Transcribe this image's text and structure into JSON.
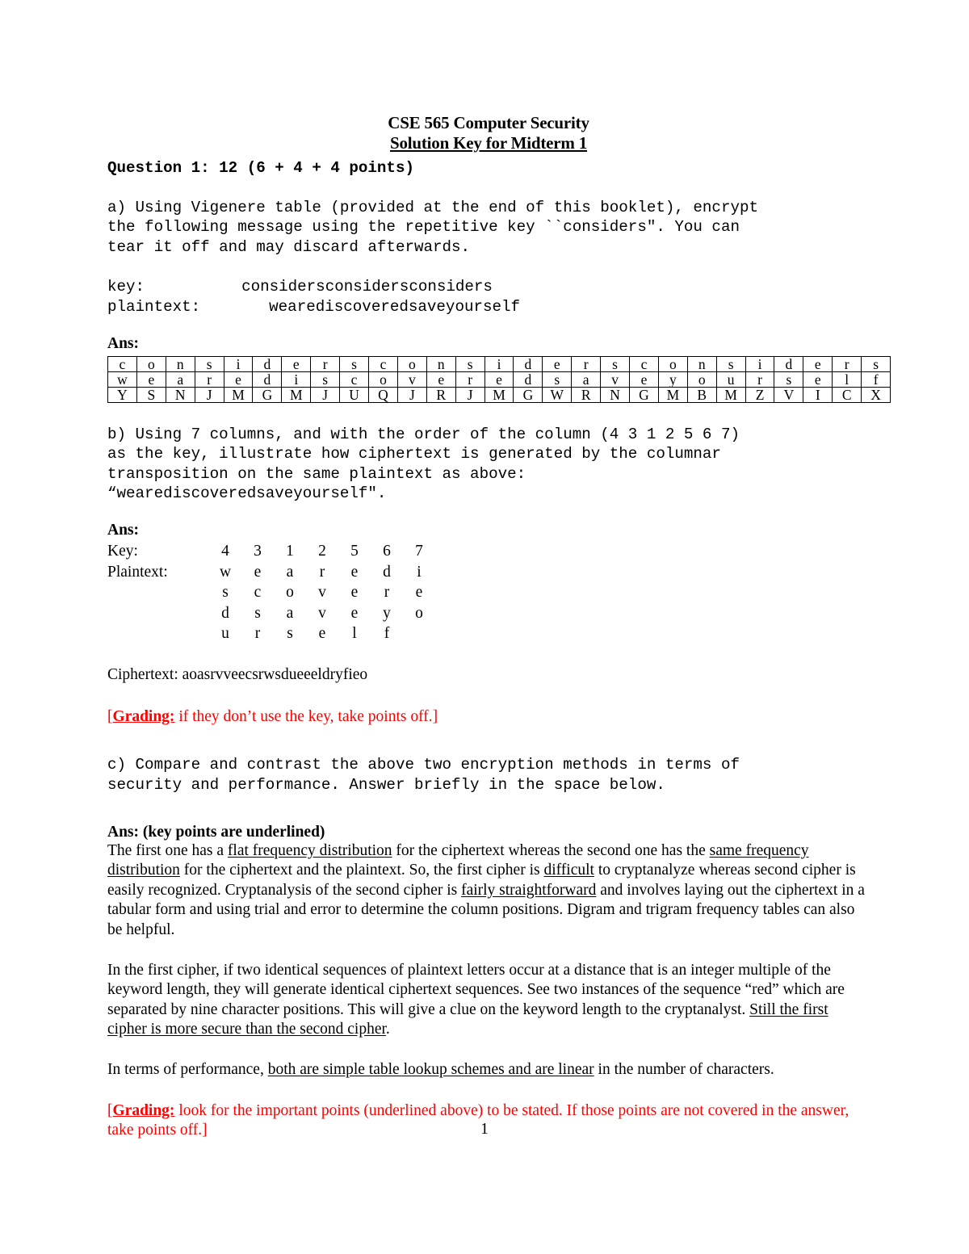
{
  "document": {
    "title": "CSE 565 Computer Security",
    "subtitle": "Solution Key for Midterm 1",
    "page_number": "1",
    "accent_red": "#ff0000"
  },
  "question": {
    "heading": "Question 1: 12 (6 + 4 + 4 points)",
    "part_a": {
      "text": "a) Using Vigenere table (provided at the end of this booklet), encrypt\nthe following message using the repetitive key ``considers\". You can\ntear it off and may discard afterwards.",
      "key_label": "key:",
      "key_value": "considersconsidersconsiders",
      "plaintext_label": "plaintext:",
      "plaintext_value": "wearediscoveredsaveyourself",
      "ans_label": "Ans:",
      "table": {
        "key_row": [
          "c",
          "o",
          "n",
          "s",
          "i",
          "d",
          "e",
          "r",
          "s",
          "c",
          "o",
          "n",
          "s",
          "i",
          "d",
          "e",
          "r",
          "s",
          "c",
          "o",
          "n",
          "s",
          "i",
          "d",
          "e",
          "r",
          "s"
        ],
        "plain_row": [
          "w",
          "e",
          "a",
          "r",
          "e",
          "d",
          "i",
          "s",
          "c",
          "o",
          "v",
          "e",
          "r",
          "e",
          "d",
          "s",
          "a",
          "v",
          "e",
          "y",
          "o",
          "u",
          "r",
          "s",
          "e",
          "l",
          "f"
        ],
        "cipher_row": [
          "Y",
          "S",
          "N",
          "J",
          "M",
          "G",
          "M",
          "J",
          "U",
          "Q",
          "J",
          "R",
          "J",
          "M",
          "G",
          "W",
          "R",
          "N",
          "G",
          "M",
          "B",
          "M",
          "Z",
          "V",
          "I",
          "C",
          "X"
        ]
      }
    },
    "part_b": {
      "text": "b) Using 7 columns, and with the order of the column (4 3 1 2 5 6 7)\nas the key, illustrate how ciphertext is generated by the columnar\ntransposition on the same plaintext as above:\n“wearediscoveredsaveyourself\".",
      "ans_label": "Ans:",
      "key_label": "Key:",
      "key_order": [
        "4",
        "3",
        "1",
        "2",
        "5",
        "6",
        "7"
      ],
      "plaintext_label": "Plaintext:",
      "grid_rows": [
        [
          "w",
          "e",
          "a",
          "r",
          "e",
          "d",
          "i"
        ],
        [
          "s",
          "c",
          "o",
          "v",
          "e",
          "r",
          "e"
        ],
        [
          "d",
          "s",
          "a",
          "v",
          "e",
          "y",
          "o"
        ],
        [
          "u",
          "r",
          "s",
          "e",
          "l",
          "f",
          ""
        ]
      ],
      "ciphertext_label": "Ciphertext:",
      "ciphertext_value": "aoasrvveecsrwsdueeeldryfieo",
      "grading_open": "[",
      "grading_bold": "Grading:",
      "grading_text": " if they don’t use the key, take points off.]"
    },
    "part_c": {
      "text": "c) Compare and contrast the above two encryption methods in terms of\nsecurity and performance. Answer briefly in the space below.",
      "ans_label": "Ans: (key points are underlined)",
      "paragraph1": {
        "s1": "The first one has a ",
        "u1": "flat frequency distribution",
        "s2": " for the ciphertext whereas the second one has the ",
        "u2": "same frequency distribution",
        "s3": " for the ciphertext and the plaintext. So, the first cipher is ",
        "u3": "difficult",
        "s4": " to cryptanalyze whereas second cipher is easily recognized. Cryptanalysis of the second cipher is ",
        "u4": "fairly straightforward",
        "s5": " and involves laying out the ciphertext in a tabular form and using trial and error to determine the column positions. Digram and trigram frequency tables can also be helpful."
      },
      "paragraph2": {
        "s1": "In the first cipher, if two identical sequences of plaintext letters occur at a distance that is an integer multiple of the keyword length, they will generate identical ciphertext sequences. See two instances of the sequence “red” which are separated by nine character positions. This will give a clue on the keyword length to the cryptanalyst. ",
        "u1": "Still the first cipher is more secure than the second cipher",
        "s2": "."
      },
      "paragraph3": {
        "s1": "In terms of performance, ",
        "u1": "both are simple table lookup schemes and are linear",
        "s2": " in the number of characters."
      },
      "grading_open": "[",
      "grading_bold": "Grading:",
      "grading_text": " look for the important points (underlined above) to be stated. If those points are not covered in the answer, take points off.]"
    }
  }
}
